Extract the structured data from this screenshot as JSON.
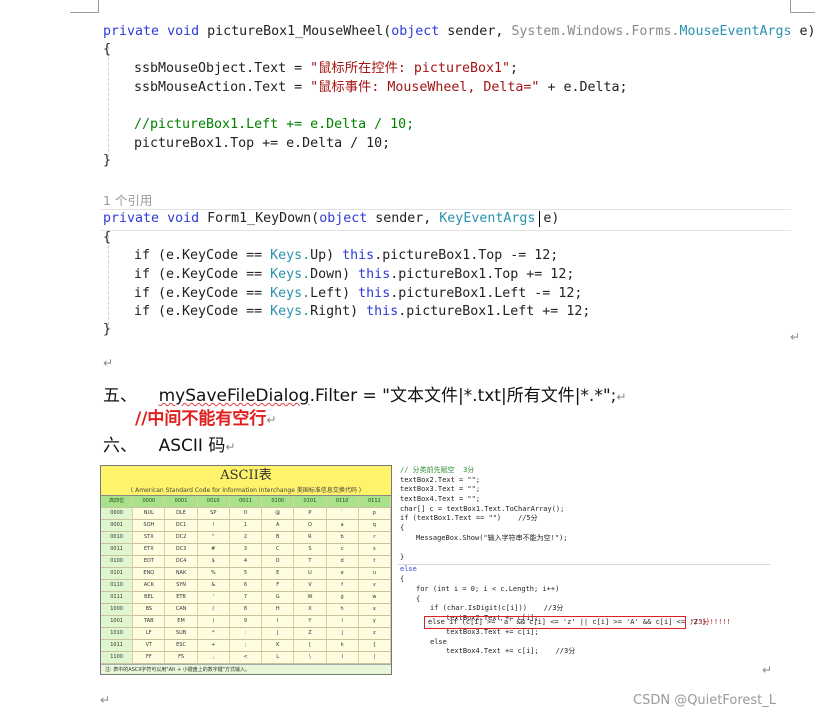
{
  "code_block_1": {
    "line1": {
      "kw1": "private",
      "kw2": "void",
      "name": "pictureBox1_MouseWheel(",
      "kw3": "object",
      "rest": " sender, ",
      "ns": "System.Windows.Forms.",
      "type": "MouseEventArgs",
      "tail": " e)"
    },
    "line2": "{",
    "line3": {
      "left": "ssbMouseObject.Text = ",
      "str": "\"鼠标所在控件: pictureBox1\"",
      "end": ";"
    },
    "line4": {
      "left": "ssbMouseAction.Text = ",
      "str": "\"鼠标事件: MouseWheel, Delta=\"",
      "end": " + e.Delta;"
    },
    "line5": "//pictureBox1.Left += e.Delta / 10;",
    "line6": "pictureBox1.Top += e.Delta / 10;",
    "line7": "}"
  },
  "refcount": "1 个引用",
  "code_block_2": {
    "line1": {
      "kw1": "private",
      "kw2": "void",
      "name": "Form1_KeyDown(",
      "kw3": "object",
      "rest": " sender, ",
      "type": "KeyEventArgs",
      "tail": " e)"
    },
    "line2": "{",
    "rows": [
      {
        "a": "if (e.KeyCode == ",
        "k": "Keys.",
        "key": "Up",
        "p": ") ",
        "th": "this",
        "r": ".pictureBox1.Top -= 12;"
      },
      {
        "a": "if (e.KeyCode == ",
        "k": "Keys.",
        "key": "Down",
        "p": ") ",
        "th": "this",
        "r": ".pictureBox1.Top += 12;"
      },
      {
        "a": "if (e.KeyCode == ",
        "k": "Keys.",
        "key": "Left",
        "p": ") ",
        "th": "this",
        "r": ".pictureBox1.Left -= 12;"
      },
      {
        "a": "if (e.KeyCode == ",
        "k": "Keys.",
        "key": "Right",
        "p": ") ",
        "th": "this",
        "r": ".pictureBox1.Left += 12;"
      }
    ],
    "line7": "}"
  },
  "para_mark": "↵",
  "section5": {
    "num": "五、",
    "squiggly": "mySaveFileDialog",
    "text": ".Filter = \"文本文件|*.txt|所有文件|*.*\";"
  },
  "section5_note": "//中间不能有空行",
  "section6": {
    "num": "六、",
    "text": "ASCII 码"
  },
  "ascii_image": {
    "title": "ASCII表",
    "subtitle": "( American Standard Code for Information Interchange  美国标准信息交换代码 )",
    "footer": "注: 表中的ASCII字符可以用\"Alt + 小键盘上的数字键\"方式输入。",
    "header": [
      "高四位",
      "0000",
      "0001",
      "0010",
      "0011",
      "0100",
      "0101",
      "0110",
      "0111"
    ],
    "rows": [
      [
        "0000",
        "NUL",
        "DLE",
        "SP",
        "0",
        "@",
        "P",
        "`",
        "p"
      ],
      [
        "0001",
        "SOH",
        "DC1",
        "!",
        "1",
        "A",
        "Q",
        "a",
        "q"
      ],
      [
        "0010",
        "STX",
        "DC2",
        "\"",
        "2",
        "B",
        "R",
        "b",
        "r"
      ],
      [
        "0011",
        "ETX",
        "DC3",
        "#",
        "3",
        "C",
        "S",
        "c",
        "s"
      ],
      [
        "0100",
        "EOT",
        "DC4",
        "$",
        "4",
        "D",
        "T",
        "d",
        "t"
      ],
      [
        "0101",
        "ENQ",
        "NAK",
        "%",
        "5",
        "E",
        "U",
        "e",
        "u"
      ],
      [
        "0110",
        "ACK",
        "SYN",
        "&",
        "6",
        "F",
        "V",
        "f",
        "v"
      ],
      [
        "0111",
        "BEL",
        "ETB",
        "'",
        "7",
        "G",
        "W",
        "g",
        "w"
      ],
      [
        "1000",
        "BS",
        "CAN",
        "(",
        "8",
        "H",
        "X",
        "h",
        "x"
      ],
      [
        "1001",
        "TAB",
        "EM",
        ")",
        "9",
        "I",
        "Y",
        "i",
        "y"
      ],
      [
        "1010",
        "LF",
        "SUB",
        "*",
        ":",
        "J",
        "Z",
        "j",
        "z"
      ],
      [
        "1011",
        "VT",
        "ESC",
        "+",
        ";",
        "K",
        "[",
        "k",
        "{"
      ],
      [
        "1100",
        "FF",
        "FS",
        ",",
        "<",
        "L",
        "\\",
        "l",
        "|"
      ],
      [
        "1101",
        "CR",
        "GS",
        "-",
        "=",
        "M",
        "]",
        "m",
        "}"
      ],
      [
        "1110",
        "SO",
        "RS",
        ".",
        ">",
        "N",
        "^",
        "n",
        "~"
      ],
      [
        "1111",
        "SI",
        "US",
        "/",
        "?",
        "O",
        "_",
        "o",
        "DEL"
      ]
    ]
  },
  "snippet": {
    "l1": "// 分类前先赋空  3分",
    "l2": "textBox2.Text = \"\";",
    "l3": "textBox3.Text = \"\";",
    "l4": "textBox4.Text = \"\";",
    "l5": "char[] c = textBox1.Text.ToCharArray();",
    "l6": "if (textBox1.Text == \"\")    //5分",
    "l7": "{",
    "l8": "MessageBox.Show(\"输入字符串不能为空!\");",
    "l9": "}",
    "l10": "else",
    "l11": "{",
    "l12": "for (int i = 0; i < c.Length; i++)",
    "l13": "{",
    "l14": "if (char.IsDigit(c[i]))    //3分",
    "l15": "textBox2.Text += c[i];",
    "l16": "else if (c[i] >= 'a' && c[i] <= 'z' || c[i] >= 'A' && c[i] <= 'Z')",
    "l16b": "//3分!!!!!",
    "l17": "textBox3.Text += c[i];",
    "l18": "else",
    "l19": "textBox4.Text += c[i];    //3分"
  },
  "watermark": "CSDN @QuietForest_L"
}
